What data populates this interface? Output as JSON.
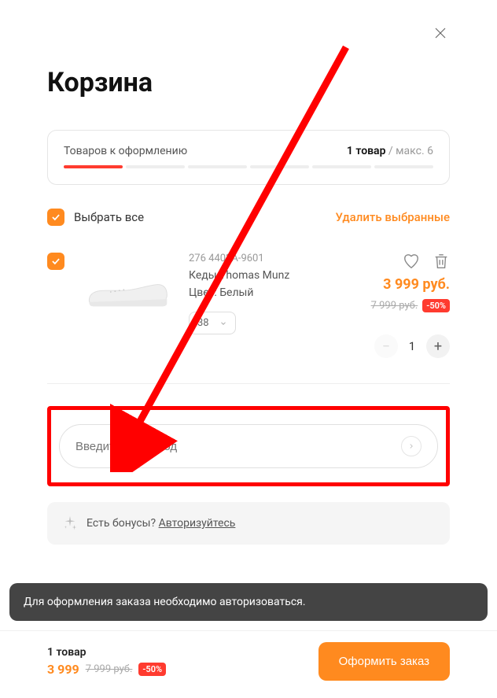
{
  "header": {
    "title": "Корзина",
    "close_aria": "Закрыть"
  },
  "progress": {
    "label": "Товаров к оформлению",
    "count_text": "1 товар",
    "max_text": " / макс. 6",
    "filled_segments": 1,
    "total_segments": 6
  },
  "selection": {
    "select_all_label": "Выбрать все",
    "delete_selected_label": "Удалить выбранные"
  },
  "item": {
    "sku": "276 4403A-9601",
    "name": "Кеды Thomas Munz",
    "color_label": "Цвет: Белый",
    "size": "38",
    "price_current": "3 999 руб.",
    "price_old": "7 999 руб.",
    "discount": "-50%",
    "quantity": "1"
  },
  "promo": {
    "placeholder": "Введите промокод"
  },
  "bonus": {
    "text": "Есть бонусы? ",
    "link": "Авторизуйтесь"
  },
  "toast": {
    "message": "Для оформления заказа необходимо авторизоваться."
  },
  "footer": {
    "count_text": "1 товар",
    "price_current": "3 999",
    "price_old": "7 999 руб.",
    "discount": "-50%",
    "checkout_label": "Оформить заказ"
  }
}
